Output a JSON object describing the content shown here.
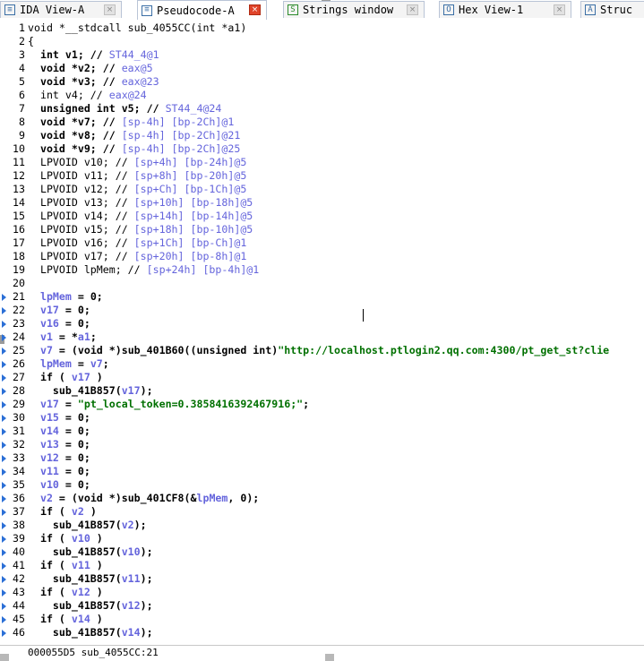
{
  "tabs": [
    {
      "label": "IDA View-A",
      "icon": "ida-view-icon",
      "active": false
    },
    {
      "label": "Pseudocode-A",
      "icon": "pseudocode-icon",
      "active": true
    },
    {
      "label": "Strings window",
      "icon": "strings-icon",
      "active": false
    },
    {
      "label": "Hex View-1",
      "icon": "hex-view-icon",
      "active": false
    },
    {
      "label": "Struc",
      "icon": "structures-icon",
      "active": false
    }
  ],
  "code": [
    {
      "n": "1",
      "arrow": false,
      "bold": false,
      "html": "void *__stdcall sub_4055CC(int *a1)"
    },
    {
      "n": "2",
      "arrow": false,
      "bold": false,
      "html": "{"
    },
    {
      "n": "3",
      "arrow": false,
      "bold": true,
      "html": "  int v1; // <span class='c'>ST44_4@1</span>"
    },
    {
      "n": "4",
      "arrow": false,
      "bold": true,
      "html": "  void *v2; // <span class='c'>eax@5</span>"
    },
    {
      "n": "5",
      "arrow": false,
      "bold": true,
      "html": "  void *v3; // <span class='c'>eax@23</span>"
    },
    {
      "n": "6",
      "arrow": false,
      "bold": false,
      "html": "  int v4; // <span class='c'>eax@24</span>"
    },
    {
      "n": "7",
      "arrow": false,
      "bold": true,
      "html": "  unsigned int v5; // <span class='c'>ST44_4@24</span>"
    },
    {
      "n": "8",
      "arrow": false,
      "bold": true,
      "html": "  void *v7; // <span class='c'>[sp-4h] [bp-2Ch]@1</span>"
    },
    {
      "n": "9",
      "arrow": false,
      "bold": true,
      "html": "  void *v8; // <span class='c'>[sp-4h] [bp-2Ch]@21</span>"
    },
    {
      "n": "10",
      "arrow": false,
      "bold": true,
      "html": "  void *v9; // <span class='c'>[sp-4h] [bp-2Ch]@25</span>"
    },
    {
      "n": "11",
      "arrow": false,
      "bold": false,
      "html": "  LPVOID v10; // <span class='c'>[sp+4h] [bp-24h]@5</span>"
    },
    {
      "n": "12",
      "arrow": false,
      "bold": false,
      "html": "  LPVOID v11; // <span class='c'>[sp+8h] [bp-20h]@5</span>"
    },
    {
      "n": "13",
      "arrow": false,
      "bold": false,
      "html": "  LPVOID v12; // <span class='c'>[sp+Ch] [bp-1Ch]@5</span>"
    },
    {
      "n": "14",
      "arrow": false,
      "bold": false,
      "html": "  LPVOID v13; // <span class='c'>[sp+10h] [bp-18h]@5</span>"
    },
    {
      "n": "15",
      "arrow": false,
      "bold": false,
      "html": "  LPVOID v14; // <span class='c'>[sp+14h] [bp-14h]@5</span>"
    },
    {
      "n": "16",
      "arrow": false,
      "bold": false,
      "html": "  LPVOID v15; // <span class='c'>[sp+18h] [bp-10h]@5</span>"
    },
    {
      "n": "17",
      "arrow": false,
      "bold": false,
      "html": "  LPVOID v16; // <span class='c'>[sp+1Ch] [bp-Ch]@1</span>"
    },
    {
      "n": "18",
      "arrow": false,
      "bold": false,
      "html": "  LPVOID v17; // <span class='c'>[sp+20h] [bp-8h]@1</span>"
    },
    {
      "n": "19",
      "arrow": false,
      "bold": false,
      "html": "  LPVOID lpMem; // <span class='c'>[sp+24h] [bp-4h]@1</span>"
    },
    {
      "n": "20",
      "arrow": false,
      "bold": false,
      "html": ""
    },
    {
      "n": "21",
      "arrow": true,
      "bold": true,
      "html": "  <span class='v'>lpMem</span> = 0;"
    },
    {
      "n": "22",
      "arrow": true,
      "bold": true,
      "html": "  <span class='v'>v17</span> = 0;"
    },
    {
      "n": "23",
      "arrow": true,
      "bold": true,
      "html": "  <span class='v'>v16</span> = 0;"
    },
    {
      "n": "24",
      "arrow": true,
      "bold": true,
      "html": "  <span class='v'>v1</span> = *<span class='v'>a1</span>;"
    },
    {
      "n": "25",
      "arrow": true,
      "bold": true,
      "html": "  <span class='v'>v7</span> = (void *)sub_401B60((unsigned int)<span class='s'>\"http://localhost.ptlogin2.qq.com:4300/pt_get_st?clie</span>"
    },
    {
      "n": "26",
      "arrow": true,
      "bold": true,
      "html": "  <span class='v'>lpMem</span> = <span class='v'>v7</span>;"
    },
    {
      "n": "27",
      "arrow": true,
      "bold": true,
      "html": "  if ( <span class='v'>v17</span> )"
    },
    {
      "n": "28",
      "arrow": true,
      "bold": true,
      "html": "    sub_41B857(<span class='v'>v17</span>);"
    },
    {
      "n": "29",
      "arrow": true,
      "bold": true,
      "html": "  <span class='v'>v17</span> = <span class='s'>\"pt_local_token=0.3858416392467916;\"</span>;"
    },
    {
      "n": "30",
      "arrow": true,
      "bold": true,
      "html": "  <span class='v'>v15</span> = 0;"
    },
    {
      "n": "31",
      "arrow": true,
      "bold": true,
      "html": "  <span class='v'>v14</span> = 0;"
    },
    {
      "n": "32",
      "arrow": true,
      "bold": true,
      "html": "  <span class='v'>v13</span> = 0;"
    },
    {
      "n": "33",
      "arrow": true,
      "bold": true,
      "html": "  <span class='v'>v12</span> = 0;"
    },
    {
      "n": "34",
      "arrow": true,
      "bold": true,
      "html": "  <span class='v'>v11</span> = 0;"
    },
    {
      "n": "35",
      "arrow": true,
      "bold": true,
      "html": "  <span class='v'>v10</span> = 0;"
    },
    {
      "n": "36",
      "arrow": true,
      "bold": true,
      "html": "  <span class='v'>v2</span> = (void *)sub_401CF8(&amp;<span class='v'>lpMem</span>, 0);"
    },
    {
      "n": "37",
      "arrow": true,
      "bold": true,
      "html": "  if ( <span class='v'>v2</span> )"
    },
    {
      "n": "38",
      "arrow": true,
      "bold": true,
      "html": "    sub_41B857(<span class='v'>v2</span>);"
    },
    {
      "n": "39",
      "arrow": true,
      "bold": true,
      "html": "  if ( <span class='v'>v10</span> )"
    },
    {
      "n": "40",
      "arrow": true,
      "bold": true,
      "html": "    sub_41B857(<span class='v'>v10</span>);"
    },
    {
      "n": "41",
      "arrow": true,
      "bold": true,
      "html": "  if ( <span class='v'>v11</span> )"
    },
    {
      "n": "42",
      "arrow": true,
      "bold": true,
      "html": "    sub_41B857(<span class='v'>v11</span>);"
    },
    {
      "n": "43",
      "arrow": true,
      "bold": true,
      "html": "  if ( <span class='v'>v12</span> )"
    },
    {
      "n": "44",
      "arrow": true,
      "bold": true,
      "html": "    sub_41B857(<span class='v'>v12</span>);"
    },
    {
      "n": "45",
      "arrow": true,
      "bold": true,
      "html": "  if ( <span class='v'>v14</span> )"
    },
    {
      "n": "46",
      "arrow": true,
      "bold": true,
      "html": "    sub_41B857(<span class='v'>v14</span>);"
    }
  ],
  "status": {
    "text": "000055D5 sub_4055CC:21"
  }
}
